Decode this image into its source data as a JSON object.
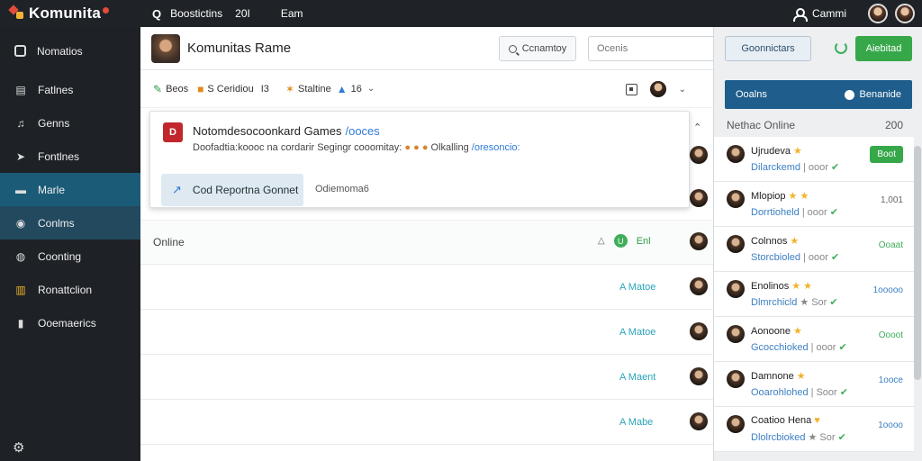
{
  "topbar": {
    "brand": "Komunita",
    "q_label": "Q",
    "items": [
      "Boostictins",
      "20I",
      "Eam"
    ],
    "user_label": "Cammi"
  },
  "sidebar": {
    "items": [
      {
        "label": "Nomatios",
        "icon": "square-outline-icon"
      },
      {
        "label": "Fatlnes",
        "icon": "document-icon"
      },
      {
        "label": "Genns",
        "icon": "music-note-icon"
      },
      {
        "label": "Fontlnes",
        "icon": "tag-icon"
      },
      {
        "label": "Marle",
        "icon": "inbox-icon"
      },
      {
        "label": "Conlms",
        "icon": "chat-icon"
      },
      {
        "label": "Coonting",
        "icon": "globe-icon"
      },
      {
        "label": "Ronattclion",
        "icon": "bars-icon"
      },
      {
        "label": "Ooemaerics",
        "icon": "file-icon"
      }
    ]
  },
  "header": {
    "group_name": "Komunitas Rame",
    "search_button": "Ccnamtoy",
    "search_placeholder": "Ocenis"
  },
  "toolbar": {
    "item1": "Beos",
    "item2_label": "S Ceridiou",
    "item2_count": "I3",
    "item3_label": "Staltine",
    "item3_count": "16"
  },
  "card": {
    "icon_text": "D",
    "title": "Notomdesocoonkard Games",
    "title_link": "/ooces",
    "desc": "Doofadtia:koooc na cordarir Segingr cooomitay:",
    "desc_tail": "Olkalling",
    "desc_tag": "/oresoncio:",
    "action_label": "Cod Reportna Gonnet",
    "meta": "Odiemoma6"
  },
  "online": {
    "label": "Online",
    "action": "Enl"
  },
  "list_rows": [
    {
      "tag": "A Matoe"
    },
    {
      "tag": "A Matoe"
    },
    {
      "tag": "A Maent"
    },
    {
      "tag": "A Mabe"
    }
  ],
  "panel": {
    "contacts_button": "Goonnictars",
    "add_button": "Aiebitad",
    "tab_a": "Ooalns",
    "tab_b": "Benanide",
    "head_left": "Nethac Online",
    "head_right": "200",
    "contacts": [
      {
        "name": "Ujrudeva",
        "stars": "★",
        "sub": "Dilarckemd",
        "sep": "|",
        "sub2": "ooor",
        "status": "Boot",
        "status_kind": "btn"
      },
      {
        "name": "Mlopiop",
        "stars": "★ ★",
        "sub": "Dorrtioheld",
        "sep": "|",
        "sub2": "ooor",
        "status": "1,001",
        "status_kind": "grey"
      },
      {
        "name": "Colnnos",
        "stars": "★",
        "sub": "Storcbioled",
        "sep": "|",
        "sub2": "ooor",
        "status": "Ooaat",
        "status_kind": "green"
      },
      {
        "name": "Enolinos",
        "stars": "★ ★",
        "sub": "Dlmrchicld",
        "sep": "★",
        "sub2": "Sor",
        "status": "1ooooo",
        "status_kind": "blue"
      },
      {
        "name": "Aonoone",
        "stars": "★",
        "sub": "Gcocchioked",
        "sep": "|",
        "sub2": "ooor",
        "status": "Oooot",
        "status_kind": "green"
      },
      {
        "name": "Damnone",
        "stars": "★",
        "sub": "Ooarohlohed",
        "sep": "|",
        "sub2": "Soor",
        "status": "1ooce",
        "status_kind": "blue"
      },
      {
        "name": "Coatioo Hena",
        "stars": "♥",
        "sub": "Dlolrcbioked",
        "sep": "★",
        "sub2": "Sor",
        "status": "1oooo",
        "status_kind": "blue"
      }
    ]
  },
  "colors": {
    "sidebar_bg": "#1e2226",
    "sidebar_active": "#1b5b78",
    "accent_green": "#37a84a",
    "accent_blue": "#1f5e8c",
    "link_blue": "#2f7bd6"
  }
}
